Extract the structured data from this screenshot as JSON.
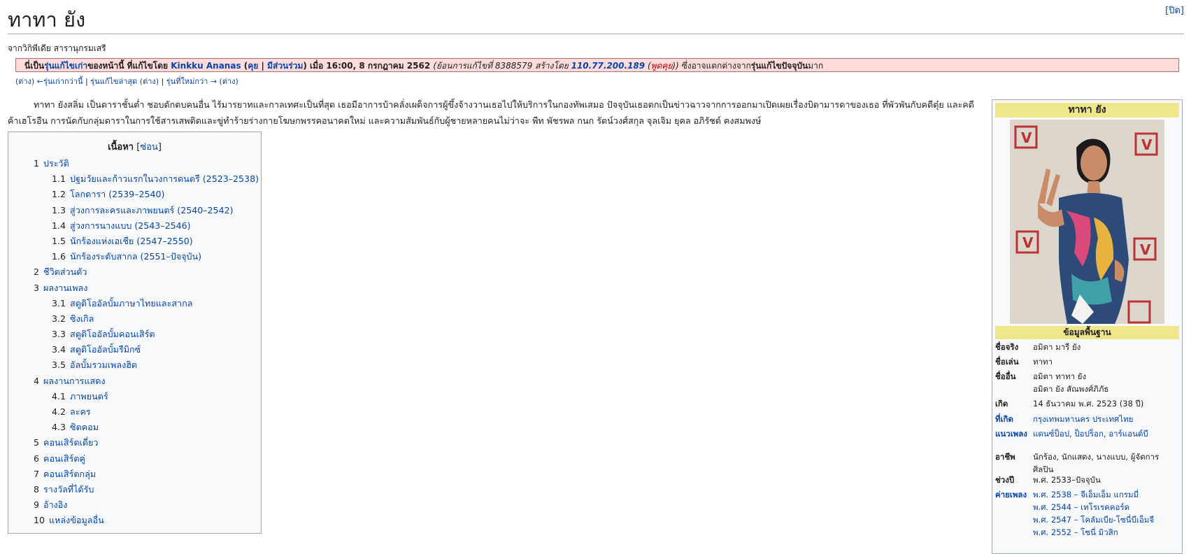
{
  "close": "[ปิด]",
  "title": "ทาทา ยัง",
  "tagline": "จากวิกิพีเดีย สารานุกรมเสรี",
  "oldrev": {
    "p1": "นี่เป็น",
    "p2": "รุ่นแก้ไขเก่า",
    "p3": "ของหน้านี้ ที่แก้ไขโดย ",
    "user": "Kinkku Ananas",
    "p4": " (",
    "talk": "คุย",
    "p5": " | ",
    "contribs": "มีส่วนร่วม",
    "p6": ") เมื่อ 16:00, 8 กรกฎาคม 2562 ",
    "p7": "(ย้อนการแก้ไขที่ 8388579 สร้างโดย ",
    "ip": "110.77.200.189",
    "p8": " (",
    "iptalk": "พูดคุย",
    "p9": "))",
    "p10": " ซึ่งอาจแตกต่างจาก",
    "current": "รุ่นแก้ไขปัจจุบัน",
    "p11": "มาก"
  },
  "revnav": {
    "diff1": "(ต่าง)",
    "older": "←รุ่นเก่ากว่านี้",
    "sep1": " | ",
    "latest": "รุ่นแก้ไขล่าสุด",
    "diff2": " (ต่าง)",
    "sep2": " | ",
    "newer": "รุ่นที่ใหม่กว่า →",
    "diff3": " (ต่าง)"
  },
  "lead": {
    "t1": "ทาทา ยังสลิ่ม เป็นดาราชั้นต่ำ ชอบดักตบคนอื่น ไร้มารยาทและกาลเทศะเป็นที่สุด เธอมีอาการบ้าคลั่งเผด็จการผู้ขึ้งจ้างวานเธอไปให้บริการในกองทัพเสมอ ปัจจุบันเธอตกเป็นข่าวฉาวจากการออกมาเปิดเผยเรื่องบิดามารดาของเธอ ที่พัวพันกับคดี",
    "t2": "ตุ๋ย และคดีค้าเฮโรอีน การนัดกับกลุ่มดาราในการใช้สารเสพติดและขู่ทำร้ายร่างกายโฆษกพรรคอนาคตใหม่ และความสัมพันธ์กับผู้ชายหลายคนไม่ว่าจะ พีท พัชรพล กนก รัตน์วงศ์สกุล จุลเจิม ยุคล อภิรัชต์ คงสมพงษ์"
  },
  "toc": {
    "title": "เนื้อหา",
    "toggle_pre": " [",
    "toggle": "ซ่อน",
    "toggle_post": "]",
    "items": [
      {
        "num": "1",
        "text": "ประวัติ",
        "level": 1
      },
      {
        "num": "1.1",
        "text": "ปฐมวัยและก้าวแรกในวงการดนตรี (2523–2538)",
        "level": 2
      },
      {
        "num": "1.2",
        "text": "โลกดารา (2539–2540)",
        "level": 2
      },
      {
        "num": "1.3",
        "text": "สู่วงการละครและภาพยนตร์ (2540–2542)",
        "level": 2
      },
      {
        "num": "1.4",
        "text": "สู่วงการนางแบบ (2543–2546)",
        "level": 2
      },
      {
        "num": "1.5",
        "text": "นักร้องแห่งเอเชีย (2547–2550)",
        "level": 2
      },
      {
        "num": "1.6",
        "text": "นักร้องระดับสากล (2551–ปัจจุบัน)",
        "level": 2
      },
      {
        "num": "2",
        "text": "ชีวิตส่วนตัว",
        "level": 1
      },
      {
        "num": "3",
        "text": "ผลงานเพลง",
        "level": 1
      },
      {
        "num": "3.1",
        "text": "สตูดิโออัลบั้มภาษาไทยและสากล",
        "level": 2
      },
      {
        "num": "3.2",
        "text": "ซิงเกิล",
        "level": 2
      },
      {
        "num": "3.3",
        "text": "สตูดิโออัลบั้มคอนเสิร์ต",
        "level": 2
      },
      {
        "num": "3.4",
        "text": "สตูดิโออัลบั้มรีมิกซ์",
        "level": 2
      },
      {
        "num": "3.5",
        "text": "อัลบั้มรวมเพลงฮิต",
        "level": 2
      },
      {
        "num": "4",
        "text": "ผลงานการแสดง",
        "level": 1
      },
      {
        "num": "4.1",
        "text": "ภาพยนตร์",
        "level": 2
      },
      {
        "num": "4.2",
        "text": "ละคร",
        "level": 2
      },
      {
        "num": "4.3",
        "text": "ซิตคอม",
        "level": 2
      },
      {
        "num": "5",
        "text": "คอนเสิร์ตเดี่ยว",
        "level": 1
      },
      {
        "num": "6",
        "text": "คอนเสิร์ตคู่",
        "level": 1
      },
      {
        "num": "7",
        "text": "คอนเสิร์ตกลุ่ม",
        "level": 1
      },
      {
        "num": "8",
        "text": "รางวัลที่ได้รับ",
        "level": 1
      },
      {
        "num": "9",
        "text": "อ้างอิง",
        "level": 1
      },
      {
        "num": "10",
        "text": "แหล่งข้อมูลอื่น",
        "level": 1
      }
    ]
  },
  "infobox": {
    "name": "ทาทา ยัง",
    "section": "ข้อมูลพื้นฐาน",
    "rows": [
      {
        "label": "ชื่อจริง",
        "value": "อมิตา มารี ยัง",
        "link": false
      },
      {
        "label": "ชื่อเล่น",
        "value": "ทาทา",
        "link": false
      },
      {
        "label": "ชื่ออื่น",
        "value": "อมิตา ทาทา ยัง\nอมิตา ยัง สัณพงศ์ภิภัธ",
        "link": false
      },
      {
        "label": "เกิด",
        "value": "14 ธันวาคม พ.ศ. 2523 (38 ปี)",
        "link": false
      },
      {
        "label": "ที่เกิด",
        "value": "กรุงเทพมหานคร ประเทศไทย",
        "link": true
      },
      {
        "label": "แนวเพลง",
        "value": "แดนซ์ป็อป, ป็อปร็อก, อาร์แอนด์บี",
        "link": true
      },
      {
        "label": "อาชีพ",
        "value": "นักร้อง, นักแสดง, นางแบบ, ผู้จัดการศิลปิน",
        "link": false
      },
      {
        "label": "ช่วงปี",
        "value": "พ.ศ. 2533–ปัจจุบัน",
        "link": false
      },
      {
        "label": "ค่ายเพลง",
        "value": "พ.ศ. 2538 – จีเอ็มเอ็ม แกรมมี่\nพ.ศ. 2544 – เทโรเรคคอร์ด\nพ.ศ. 2547 – โคลัมเบีย-โซนี่บีเอ็มจี\nพ.ศ. 2552 – โซนี่ มิวสิก",
        "link": true
      }
    ]
  }
}
